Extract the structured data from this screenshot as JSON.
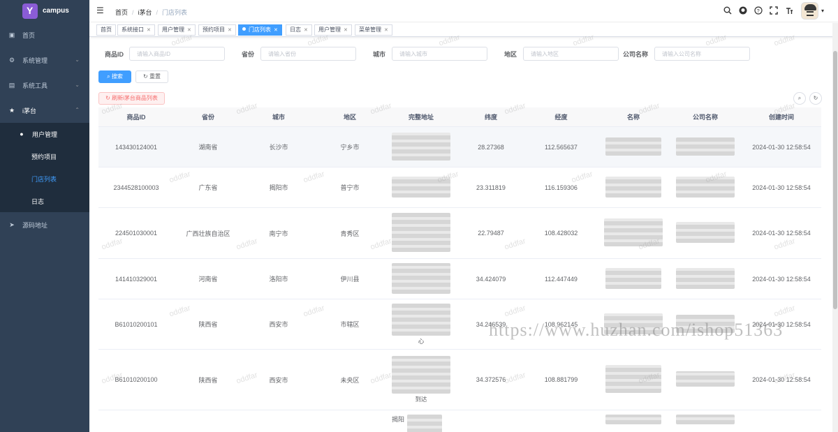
{
  "app": {
    "name": "campus"
  },
  "sidebar": {
    "items": [
      {
        "label": "首页",
        "icon": "dashboard-icon"
      },
      {
        "label": "系统管理",
        "icon": "gear-icon"
      },
      {
        "label": "系统工具",
        "icon": "toolbox-icon"
      },
      {
        "label": "i茅台",
        "icon": "star-icon"
      }
    ],
    "sub": [
      {
        "label": "用户管理"
      },
      {
        "label": "预约项目"
      },
      {
        "label": "门店列表"
      },
      {
        "label": "日志"
      }
    ],
    "source": {
      "label": "源码地址",
      "icon": "send-icon"
    }
  },
  "header": {
    "breadcrumb": [
      "首页",
      "i茅台",
      "门店列表"
    ]
  },
  "tags": [
    "首页",
    "系统接口",
    "用户管理",
    "预约项目",
    "门店列表",
    "日志",
    "用户管理",
    "菜单管理"
  ],
  "form": {
    "fields": [
      {
        "label": "商品ID",
        "placeholder": "请输入商品ID"
      },
      {
        "label": "省份",
        "placeholder": "请输入省份"
      },
      {
        "label": "城市",
        "placeholder": "请输入城市"
      },
      {
        "label": "地区",
        "placeholder": "请输入地区"
      },
      {
        "label": "公司名称",
        "placeholder": "请输入公司名称"
      }
    ],
    "search_label": "搜索",
    "reset_label": "重置",
    "refresh_label": "刷新i茅台商品列表"
  },
  "table": {
    "columns": [
      "商品ID",
      "省份",
      "城市",
      "地区",
      "完整地址",
      "纬度",
      "经度",
      "名称",
      "公司名称",
      "创建时间"
    ],
    "rows": [
      {
        "id": "143430124001",
        "province": "湖南省",
        "city": "长沙市",
        "district": "宁乡市",
        "addr": "",
        "lat": "28.27368",
        "lng": "112.565637",
        "time": "2024-01-30 12:58:54"
      },
      {
        "id": "2344528100003",
        "province": "广东省",
        "city": "揭阳市",
        "district": "普宁市",
        "addr": "",
        "lat": "23.311819",
        "lng": "116.159306",
        "time": "2024-01-30 12:58:54"
      },
      {
        "id": "224501030001",
        "province": "广西壮族自治区",
        "city": "南宁市",
        "district": "青秀区",
        "addr": "",
        "lat": "22.79487",
        "lng": "108.428032",
        "time": "2024-01-30 12:58:54"
      },
      {
        "id": "141410329001",
        "province": "河南省",
        "city": "洛阳市",
        "district": "伊川县",
        "addr": "",
        "lat": "34.424079",
        "lng": "112.447449",
        "time": "2024-01-30 12:58:54"
      },
      {
        "id": "B61010200101",
        "province": "陕西省",
        "city": "西安市",
        "district": "市辖区",
        "addr": "心",
        "lat": "34.246539",
        "lng": "108.962145",
        "time": "2024-01-30 12:58:54"
      },
      {
        "id": "B61010200100",
        "province": "陕西省",
        "city": "西安市",
        "district": "未央区",
        "addr": "到达",
        "lat": "34.372576",
        "lng": "108.881799",
        "time": "2024-01-30 12:58:54"
      },
      {
        "id": "",
        "province": "",
        "city": "",
        "district": "",
        "addr": "揭阳",
        "lat": "",
        "lng": "",
        "time": ""
      }
    ]
  },
  "watermark": {
    "text": "oddfar",
    "url": "https://www.huzhan.com/ishop51363"
  }
}
